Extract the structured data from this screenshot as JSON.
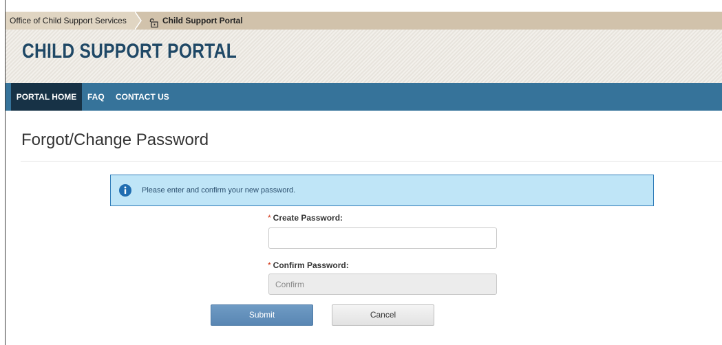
{
  "breadcrumb": {
    "parent": "Office of Child Support Services",
    "current": "Child Support Portal",
    "current_icon": "lock-icon"
  },
  "header": {
    "title": "CHILD SUPPORT PORTAL"
  },
  "nav": {
    "items": [
      {
        "label": "PORTAL HOME",
        "active": true
      },
      {
        "label": "FAQ",
        "active": false
      },
      {
        "label": "CONTACT US",
        "active": false
      }
    ]
  },
  "page": {
    "title": "Forgot/Change Password"
  },
  "info": {
    "icon": "info-icon",
    "message": "Please enter and confirm your new password."
  },
  "form": {
    "required_marker": "*",
    "create_password": {
      "label": "Create Password:",
      "value": "",
      "placeholder": ""
    },
    "confirm_password": {
      "label": "Confirm Password:",
      "value": "",
      "placeholder": "Confirm"
    },
    "submit_label": "Submit",
    "cancel_label": "Cancel"
  },
  "colors": {
    "nav_bg": "#36739a",
    "nav_active_bg": "#173246",
    "title_color": "#1f4866",
    "info_bg": "#bfe5f7",
    "info_border": "#2e7bb8",
    "submit_bg": "#5986b3",
    "required": "#d13212"
  }
}
